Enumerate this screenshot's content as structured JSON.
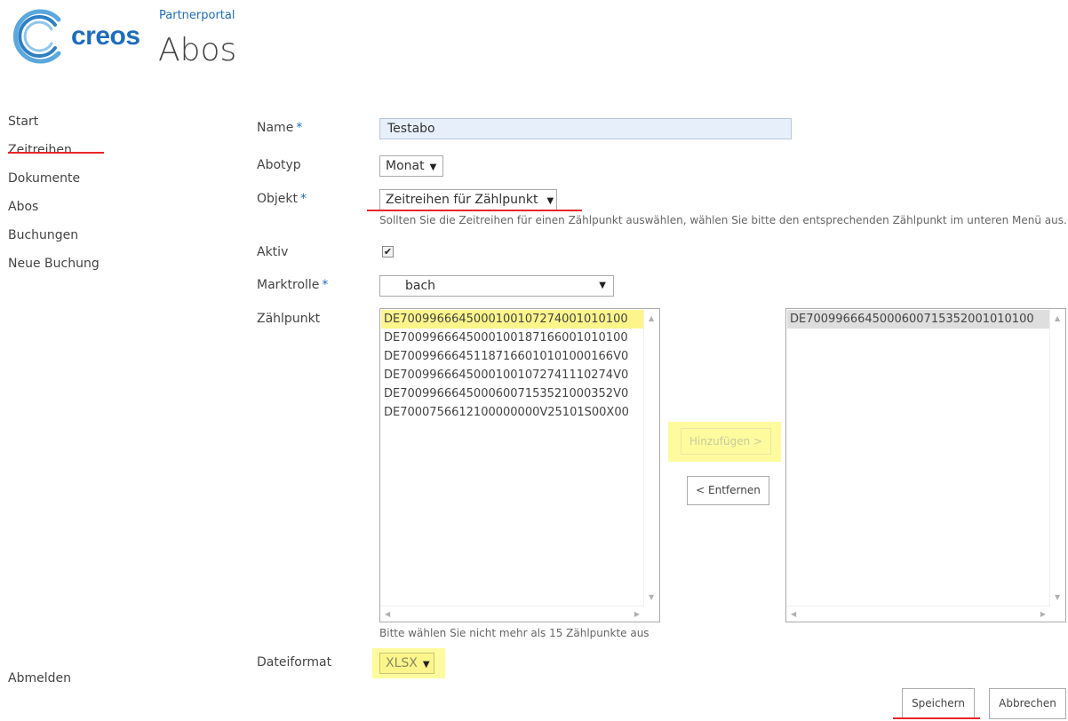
{
  "colors": {
    "brand_blue": "#1e6dbc",
    "text": "#444444",
    "highlight": "#fdfb9d",
    "annotation_red": "#e8262a"
  },
  "header": {
    "logo_text": "creos",
    "site_title": "Partnerportal",
    "page_title": "Abos"
  },
  "nav": {
    "items": [
      {
        "label": "Start"
      },
      {
        "label": "Zeitreihen"
      },
      {
        "label": "Dokumente"
      },
      {
        "label": "Abos"
      },
      {
        "label": "Buchungen"
      },
      {
        "label": "Neue Buchung"
      }
    ],
    "logout": "Abmelden"
  },
  "form": {
    "required_marker": "*",
    "name": {
      "label": "Name",
      "value": "Testabo"
    },
    "abotyp": {
      "label": "Abotyp",
      "value": "Monat"
    },
    "objekt": {
      "label": "Objekt",
      "value": "Zeitreihen für Zählpunkt",
      "hint": "Sollten Sie die Zeitreihen für einen Zählpunkt auswählen, wählen Sie bitte den entsprechenden Zählpunkt im unteren Menü aus."
    },
    "aktiv": {
      "label": "Aktiv",
      "checked": true,
      "check_glyph": "✔"
    },
    "marktrolle": {
      "label": "Marktrolle",
      "value": "bach"
    },
    "zaehlpunkt": {
      "label": "Zählpunkt",
      "available": [
        "DE700996664500010010727400101010​0",
        "DE7009966645000100187166001010100",
        "DE70099666451187166010101000166V0",
        "DE70099666450001001072741110274V0",
        "DE70099666450006007153521000352V0",
        "DE7000756612100000000V25101S00X00"
      ],
      "selected": [
        "DE7009966645000600715352001010100"
      ],
      "add_button": "Hinzufügen >",
      "remove_button": "< Entfernen",
      "hint": "Bitte wählen Sie nicht mehr als 15 Zählpunkte aus"
    },
    "dateiformat": {
      "label": "Dateiformat",
      "value": "XLSX"
    }
  },
  "actions": {
    "save": "Speichern",
    "cancel": "Abbrechen"
  }
}
